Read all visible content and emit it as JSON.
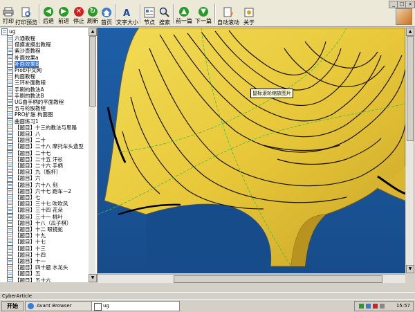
{
  "toolbar": {
    "buttons": [
      {
        "label": "打印",
        "icon": "print-icon"
      },
      {
        "label": "打印预览",
        "icon": "print-preview-icon"
      },
      {
        "label": "后退",
        "icon": "back-arrow-icon"
      },
      {
        "label": "前进",
        "icon": "forward-arrow-icon"
      },
      {
        "label": "停止",
        "icon": "stop-icon"
      },
      {
        "label": "刷新",
        "icon": "refresh-icon"
      },
      {
        "label": "首页",
        "icon": "home-icon"
      },
      {
        "label": "文字大小",
        "icon": "text-size-icon"
      },
      {
        "label": "节点",
        "icon": "node-icon"
      },
      {
        "label": "搜索",
        "icon": "search-icon"
      },
      {
        "label": "前一篇",
        "icon": "previous-article-icon"
      },
      {
        "label": "下一篇",
        "icon": "next-article-icon"
      },
      {
        "label": "自动滚动",
        "icon": "auto-scroll-icon"
      },
      {
        "label": "关于",
        "icon": "about-icon"
      }
    ]
  },
  "tree": {
    "root": "ug",
    "selected_index": 4,
    "items": [
      "六通教程",
      "借摸发摸出教程",
      "紫沙壶教程",
      "补面效果a",
      "补面效果B",
      "ProE中文网",
      "构面教程",
      "三环补面教程",
      "手刷的教法A",
      "手刷的教法B",
      "UG曲手柄的平面教程",
      "五号轮股教程",
      "PRO扩胀 构面图",
      "曲面练习1",
      "【题目】十三的教法与思路",
      "【题目】八",
      "【题目】二十",
      "【题目】二十八 摩托车头造型",
      "【题目】二十七",
      "【题目】二十五 汗衫",
      "【题目】二十六 手柄",
      "【题目】九（瓶杆）",
      "【题目】六",
      "【题目】六十八 刻",
      "【题目】六十七 跑车－2",
      "【题目】七",
      "【题目】三十七 吹吹风",
      "【题目】三十四 花朵",
      "【题目】三十一 桃叶",
      "【题目】十八（瓜子棋）",
      "【题目】十二 眼镜蛇",
      "【题目】十九",
      "【题目】十七",
      "【题目】十三",
      "【题目】十四",
      "【题目】十一",
      "【题目】四十题 水龙头",
      "【题目】五",
      "【题目】五十六"
    ]
  },
  "viewport": {
    "tooltip": "鼠标滚轮缩放图片",
    "surface_color": "#e8c83a",
    "background_color": "#1a5a9e"
  },
  "status": {
    "text": "CyberArticle"
  },
  "taskbar": {
    "start_label": "开始",
    "tasks": [
      "Avant Browser",
      "ug"
    ],
    "clock": "15:57"
  }
}
